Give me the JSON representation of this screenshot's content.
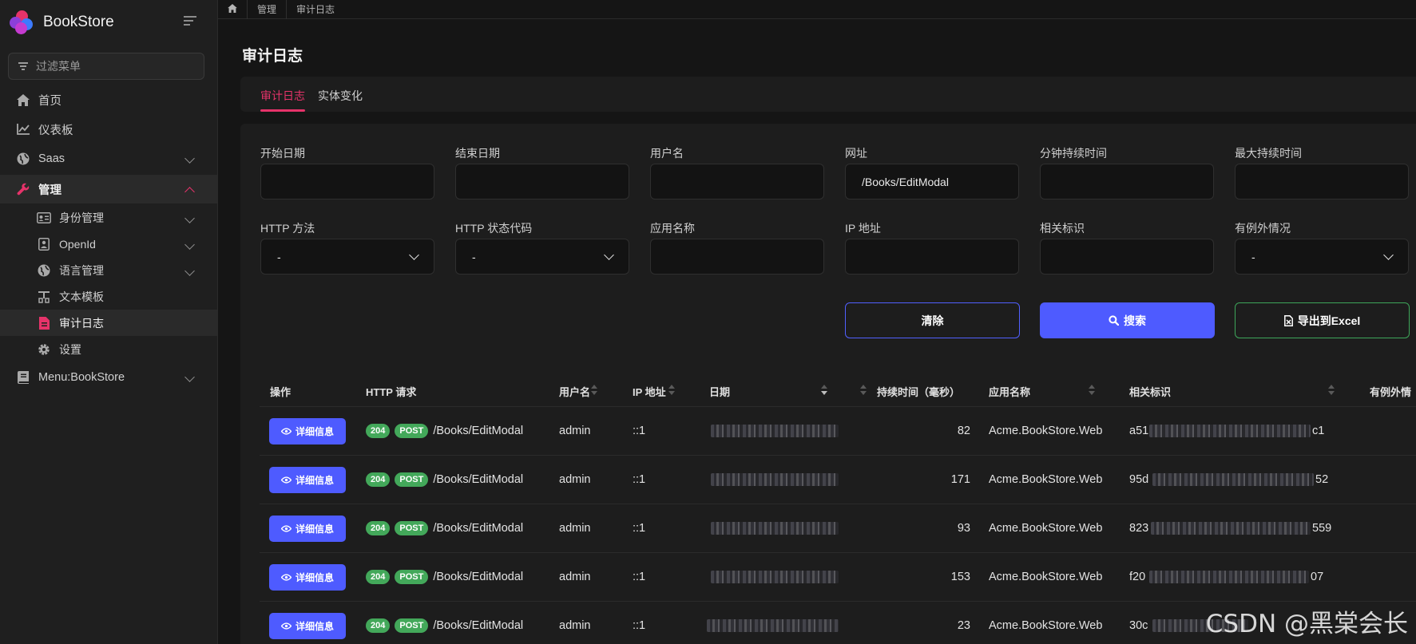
{
  "app": {
    "title": "BookStore"
  },
  "sidebar": {
    "filter_placeholder": "过滤菜单",
    "items": [
      {
        "label": "首页"
      },
      {
        "label": "仪表板"
      },
      {
        "label": "Saas"
      },
      {
        "label": "管理"
      },
      {
        "label": "身份管理"
      },
      {
        "label": "OpenId"
      },
      {
        "label": "语言管理"
      },
      {
        "label": "文本模板"
      },
      {
        "label": "审计日志"
      },
      {
        "label": "设置"
      },
      {
        "label": "Menu:BookStore"
      }
    ]
  },
  "breadcrumb": [
    "管理",
    "审计日志"
  ],
  "page": {
    "title": "审计日志"
  },
  "tabs": [
    "审计日志",
    "实体变化"
  ],
  "filters": {
    "start_date": {
      "label": "开始日期",
      "value": ""
    },
    "end_date": {
      "label": "结束日期",
      "value": ""
    },
    "username": {
      "label": "用户名",
      "value": ""
    },
    "url": {
      "label": "网址",
      "value": "/Books/EditModal"
    },
    "min_duration": {
      "label": "分钟持续时间",
      "value": ""
    },
    "max_duration": {
      "label": "最大持续时间",
      "value": ""
    },
    "http_method": {
      "label": "HTTP 方法",
      "value": "-"
    },
    "http_status": {
      "label": "HTTP 状态代码",
      "value": "-"
    },
    "app_name": {
      "label": "应用名称",
      "value": ""
    },
    "ip": {
      "label": "IP 地址",
      "value": ""
    },
    "correlation": {
      "label": "相关标识",
      "value": ""
    },
    "has_exception": {
      "label": "有例外情况",
      "value": "-"
    }
  },
  "buttons": {
    "clear": "清除",
    "search": "搜索",
    "export": "导出到Excel"
  },
  "table": {
    "headers": [
      "操作",
      "HTTP 请求",
      "用户名",
      "IP 地址",
      "日期",
      "持续时间（毫秒）",
      "应用名称",
      "相关标识",
      "有例外情"
    ],
    "details_label": "详细信息",
    "rows": [
      {
        "status": "204",
        "method": "POST",
        "url": "/Books/EditModal",
        "user": "admin",
        "ip": "::1",
        "duration": "82",
        "app": "Acme.BookStore.Web",
        "corr_start": "a51",
        "corr_end": "c1"
      },
      {
        "status": "204",
        "method": "POST",
        "url": "/Books/EditModal",
        "user": "admin",
        "ip": "::1",
        "duration": "171",
        "app": "Acme.BookStore.Web",
        "corr_start": "95d",
        "corr_end": "52"
      },
      {
        "status": "204",
        "method": "POST",
        "url": "/Books/EditModal",
        "user": "admin",
        "ip": "::1",
        "duration": "93",
        "app": "Acme.BookStore.Web",
        "corr_start": "823",
        "corr_end": "559"
      },
      {
        "status": "204",
        "method": "POST",
        "url": "/Books/EditModal",
        "user": "admin",
        "ip": "::1",
        "duration": "153",
        "app": "Acme.BookStore.Web",
        "corr_start": "f20",
        "corr_end": "07"
      },
      {
        "status": "204",
        "method": "POST",
        "url": "/Books/EditModal",
        "user": "admin",
        "ip": "::1",
        "duration": "23",
        "app": "Acme.BookStore.Web",
        "corr_start": "30c",
        "corr_end": ""
      }
    ]
  },
  "watermark": "CSDN @黑棠会长",
  "colors": {
    "accent": "#e6336a",
    "primary": "#4e5bff",
    "success": "#43a85a",
    "bg": "#151515",
    "sidebar": "#1f1f1f"
  }
}
